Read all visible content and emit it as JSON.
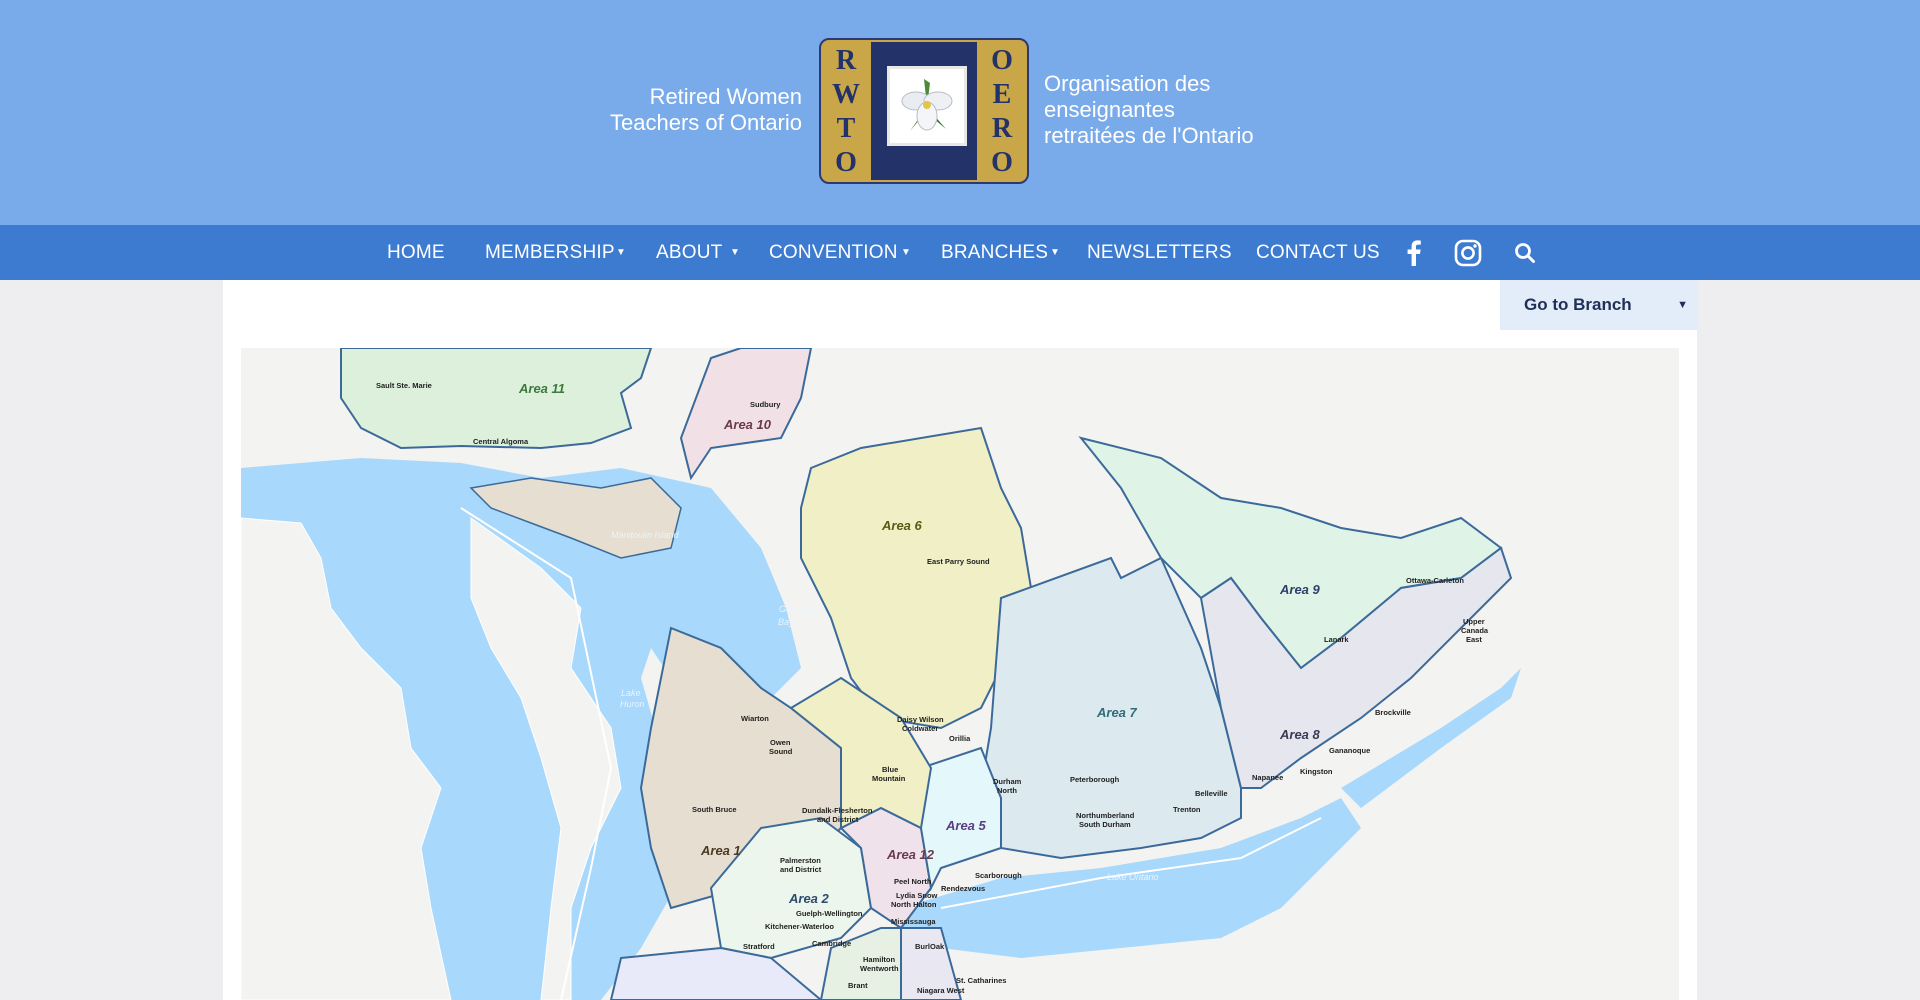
{
  "header": {
    "org_en_line1": "Retired Women",
    "org_en_line2": "Teachers of Ontario",
    "org_fr_line1": "Organisation des",
    "org_fr_line2": "enseignantes",
    "org_fr_line3": "retraitées de l'Ontario",
    "logo_left_letters": [
      "R",
      "W",
      "T",
      "O"
    ],
    "logo_right_letters": [
      "O",
      "E",
      "R",
      "O"
    ],
    "header_color": "#79aaea"
  },
  "nav": {
    "color": "#3d7bd1",
    "items": [
      {
        "label": "HOME"
      },
      {
        "label": "MEMBERSHIP"
      },
      {
        "label": "ABOUT"
      },
      {
        "label": "CONVENTION"
      },
      {
        "label": "BRANCHES"
      },
      {
        "label": "NEWSLETTERS"
      },
      {
        "label": "CONTACT US"
      }
    ],
    "icons": [
      "facebook-icon",
      "instagram-icon",
      "search-icon"
    ]
  },
  "branch_select": {
    "label": "Go to Branch"
  },
  "map": {
    "areas": {
      "a1": "Area 1",
      "a2": "Area 2",
      "a5": "Area\n5",
      "a6": "Area 6",
      "a7": "Area 7",
      "a8": "Area 8",
      "a9": "Area 9",
      "a10": "Area 10",
      "a11": "Area 11",
      "a12": "Area\n12"
    },
    "places": {
      "sault": "Sault Ste. Marie",
      "central_algoma": "Central Algoma",
      "sudbury": "Sudbury",
      "manitoulin": "Manitoulin Island",
      "east_parry": "East Parry Sound",
      "ottawa": "Ottawa-Carleton",
      "lanark": "Lanark",
      "upper_canada_1": "Upper",
      "upper_canada_2": "Canada",
      "upper_canada_3": "East",
      "brockville": "Brockville",
      "gananoque": "Gananoque",
      "napanee": "Napanee",
      "kingston": "Kingston",
      "peterborough": "Peterborough",
      "durham_1": "Durham",
      "durham_2": "North",
      "belleville": "Belleville",
      "trenton": "Trenton",
      "northumberland_1": "Northumberland",
      "northumberland_2": "South Durham",
      "daisy_1": "Daisy Wilson",
      "daisy_2": "Coldwater",
      "orillia": "Orillia",
      "wiarton": "Wiarton",
      "owen_1": "Owen",
      "owen_2": "Sound",
      "blue_1": "Blue",
      "blue_2": "Mountain",
      "south_bruce": "South Bruce",
      "dundalk_1": "Dundalk-Flesherton",
      "dundalk_2": "and District",
      "palmerston_1": "Palmerston",
      "palmerston_2": "and District",
      "guelph": "Guelph-Wellington",
      "kitchener": "Kitchener-Waterloo",
      "stratford": "Stratford",
      "cambridge": "Cambridge",
      "peel": "Peel North",
      "lydia_1": "Lydia Snow",
      "lydia_2": "North Halton",
      "mississauga": "Mississauga",
      "scarborough": "Scarborough",
      "rendezvous": "Rendezvous",
      "burloak": "BurlOak",
      "hamilton_1": "Hamilton",
      "hamilton_2": "Wentworth",
      "brant": "Brant",
      "stcath": "St. Catharines",
      "niagara": "Niagara West"
    },
    "water": {
      "georgian_1": "Georgian",
      "georgian_2": "Bay",
      "huron_1": "Lake",
      "huron_2": "Huron",
      "ontario": "Lake Ontario"
    }
  }
}
